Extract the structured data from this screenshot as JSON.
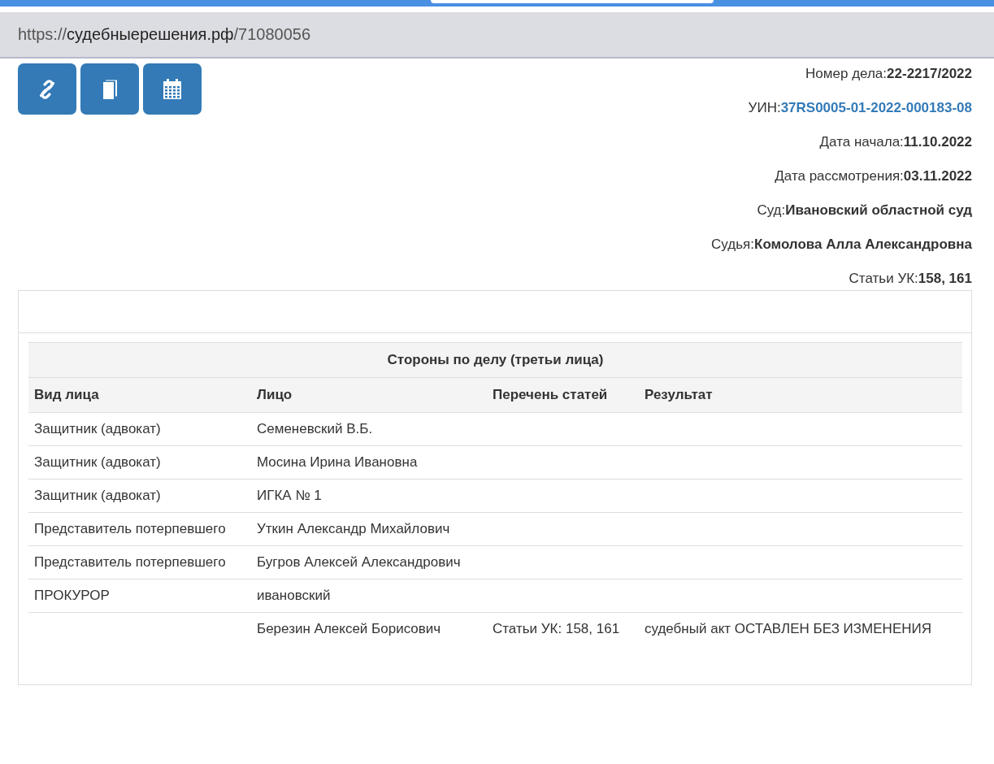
{
  "address_bar": {
    "scheme": "https://",
    "host": "судебныерешения.рф",
    "path": "/71080056"
  },
  "toolbar_buttons": [
    {
      "kind": "link"
    },
    {
      "kind": "book"
    },
    {
      "kind": "calendar"
    }
  ],
  "case_info": [
    {
      "label": "Номер дела:",
      "value": "22-2217/2022",
      "kind": "text"
    },
    {
      "label": "УИН:",
      "value": "37RS0005-01-2022-000183-08",
      "kind": "link"
    },
    {
      "label": "Дата начала:",
      "value": "11.10.2022",
      "kind": "text"
    },
    {
      "label": "Дата рассмотрения:",
      "value": "03.11.2022",
      "kind": "text"
    },
    {
      "label": "Суд:",
      "value": "Ивановский областной суд",
      "kind": "text"
    },
    {
      "label": "Судья:",
      "value": "Комолова Алла Александровна",
      "kind": "text"
    },
    {
      "label": "Статьи УК:",
      "value": "158, 161",
      "kind": "text"
    }
  ],
  "parties_table": {
    "title": "Стороны по делу (третьи лица)",
    "columns": [
      "Вид лица",
      "Лицо",
      "Перечень статей",
      "Результат"
    ],
    "rows": [
      [
        "Защитник (адвокат)",
        "Семеневский В.Б.",
        "",
        ""
      ],
      [
        "Защитник (адвокат)",
        "Мосина Ирина Ивановна",
        "",
        ""
      ],
      [
        "Защитник (адвокат)",
        "ИГКА № 1",
        "",
        ""
      ],
      [
        "Представитель потерпевшего",
        "Уткин Александр Михайлович",
        "",
        ""
      ],
      [
        "Представитель потерпевшего",
        "Бугров Алексей Александрович",
        "",
        ""
      ],
      [
        "ПРОКУРОР",
        "ивановский",
        "",
        ""
      ],
      [
        "",
        "Березин Алексей Борисович",
        "Статьи УК: 158, 161",
        "судебный акт ОСТАВЛЕН БЕЗ ИЗМЕНЕНИЯ"
      ]
    ]
  }
}
